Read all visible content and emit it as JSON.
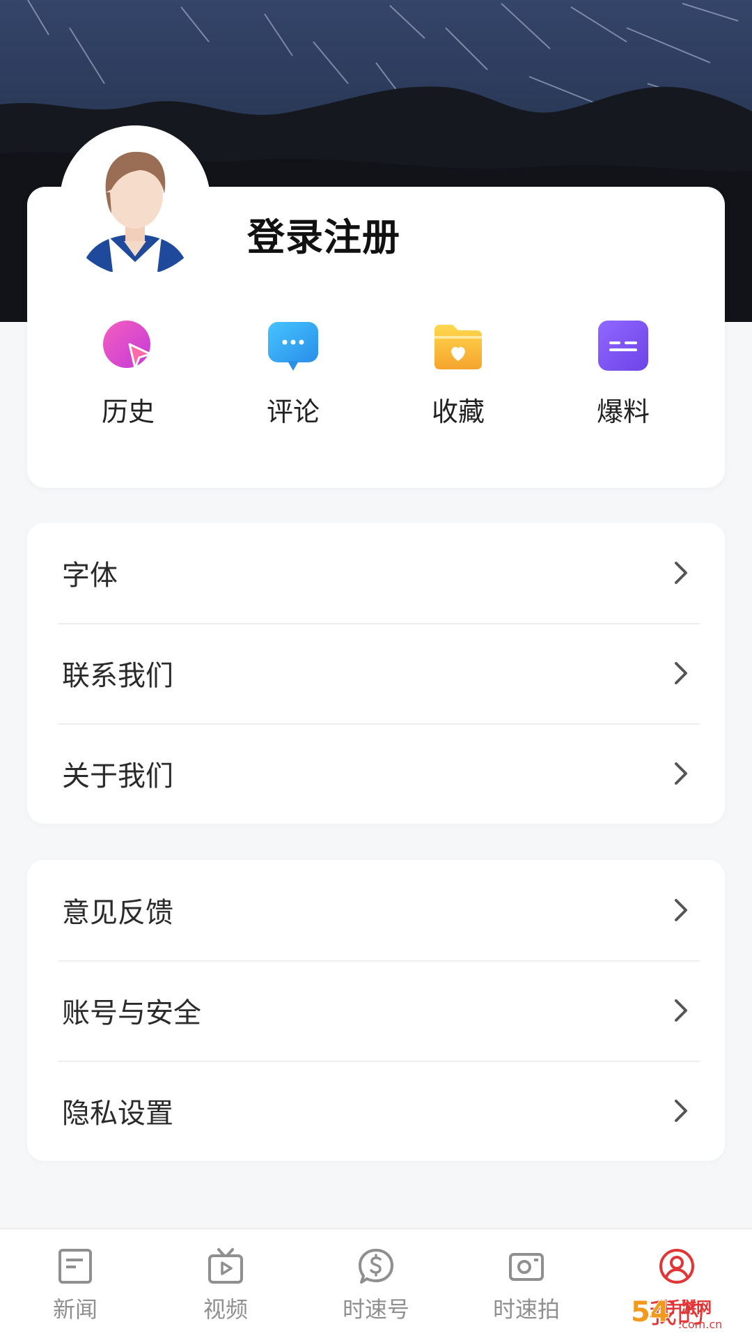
{
  "profile": {
    "login_label": "登录注册"
  },
  "quick_actions": [
    {
      "label": "历史",
      "icon": "history-icon",
      "color": "#e84fbf"
    },
    {
      "label": "评论",
      "icon": "comment-icon",
      "color": "#2fa6f1"
    },
    {
      "label": "收藏",
      "icon": "favorites-icon",
      "color": "#f5b937"
    },
    {
      "label": "爆料",
      "icon": "report-icon",
      "color": "#7e56f0"
    }
  ],
  "menu_group_1": [
    {
      "label": "字体"
    },
    {
      "label": "联系我们"
    },
    {
      "label": "关于我们"
    }
  ],
  "menu_group_2": [
    {
      "label": "意见反馈"
    },
    {
      "label": "账号与安全"
    },
    {
      "label": "隐私设置"
    }
  ],
  "tabs": [
    {
      "label": "新闻",
      "icon": "news-icon",
      "active": false
    },
    {
      "label": "视频",
      "icon": "video-icon",
      "active": false
    },
    {
      "label": "时速号",
      "icon": "shisu-account-icon",
      "active": false
    },
    {
      "label": "时速拍",
      "icon": "camera-icon",
      "active": false
    },
    {
      "label": "我的",
      "icon": "profile-icon",
      "active": true
    }
  ],
  "colors": {
    "accent": "#e23636",
    "inactive": "#8f8f8f"
  },
  "watermark": {
    "logo_text": "54手游网",
    "domain_text": ".com.cn"
  }
}
